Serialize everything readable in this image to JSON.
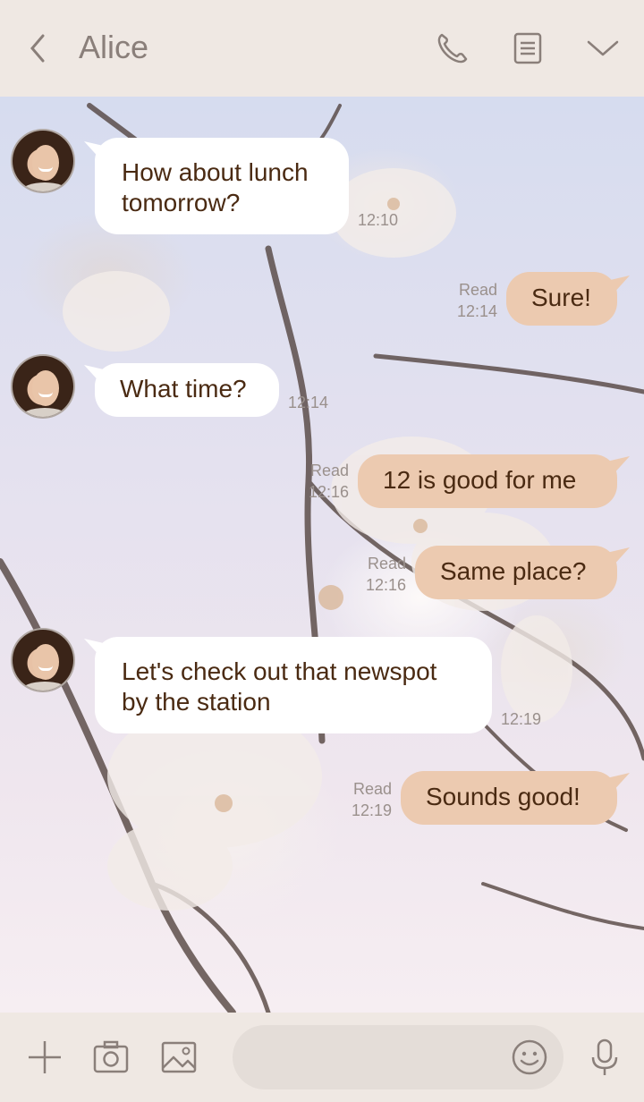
{
  "header": {
    "title": "Alice",
    "icons": [
      "back-chevron-icon",
      "phone-icon",
      "notes-icon",
      "chevron-down-icon"
    ]
  },
  "messages": [
    {
      "direction": "in",
      "text_lines": [
        "How about lunch",
        "tomorrow?"
      ],
      "time": "12:10"
    },
    {
      "direction": "out",
      "text_lines": [
        "Sure!"
      ],
      "read": "Read",
      "time": "12:14"
    },
    {
      "direction": "in",
      "text_lines": [
        "What time?"
      ],
      "time": "12:14"
    },
    {
      "direction": "out",
      "text_lines": [
        "12 is good for me"
      ],
      "read": "Read",
      "time": "12:16"
    },
    {
      "direction": "out",
      "text_lines": [
        "Same place?"
      ],
      "read": "Read",
      "time": "12:16"
    },
    {
      "direction": "in",
      "text_lines": [
        "Let's check out that newspot",
        "by the station"
      ],
      "time": "12:19"
    },
    {
      "direction": "out",
      "text_lines": [
        "Sounds good!"
      ],
      "read": "Read",
      "time": "12:19"
    }
  ],
  "footer": {
    "icons": [
      "plus-icon",
      "camera-icon",
      "image-icon",
      "emoji-icon",
      "microphone-icon"
    ],
    "input_placeholder": ""
  },
  "colors": {
    "header_bg": "#efe8e3",
    "incoming_bubble": "#ffffff",
    "outgoing_bubble": "#eccab0",
    "message_text": "#4a2a12",
    "meta_text": "#9a908c"
  }
}
